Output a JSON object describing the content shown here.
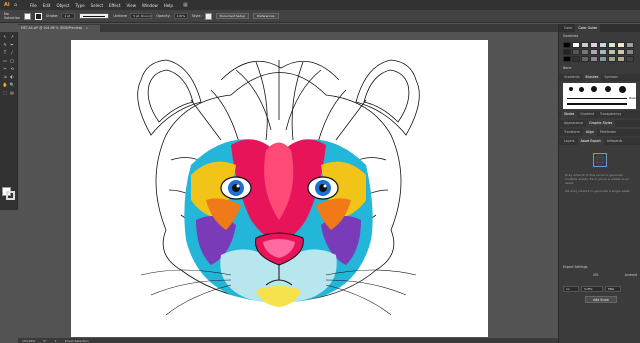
{
  "menubar": {
    "logo": "Ai",
    "home": "⌂",
    "items": [
      "File",
      "Edit",
      "Object",
      "Type",
      "Select",
      "Effect",
      "View",
      "Window",
      "Help"
    ],
    "grid": "▦"
  },
  "options": {
    "selection_label": "No Selection",
    "stroke_label": "Stroke:",
    "stroke_weight": "1 pt",
    "profile": "Uniform",
    "brush": "5 pt. Round",
    "opacity_label": "Opacity:",
    "opacity_value": "100%",
    "style_label": "Style:",
    "doc_setup": "Document Setup",
    "preferences": "Preferences"
  },
  "document_tab": {
    "title": "MET-A4.ai* @ 104.96 % (RGB/Preview)",
    "close": "×"
  },
  "tools": [
    "↖",
    "↗",
    "✎",
    "✒",
    "T",
    "/",
    "▭",
    "◯",
    "✂",
    "⟲",
    "⇲",
    "◐",
    "✋",
    "🔍",
    "⬚",
    "▤"
  ],
  "right_dock": {
    "top_tabs": [
      "Color",
      "Color Guide"
    ],
    "swatches_label": "Swatches",
    "swatch_colors": [
      "#000000",
      "#ffffff",
      "#cccccc",
      "#e0d0d8",
      "#c8d8e0",
      "#d8e8d0",
      "#f0e8d0",
      "#a0a0a0",
      "#222222",
      "#555555",
      "#777777",
      "#b0a8b0",
      "#a8b8c0",
      "#b8c8b0",
      "#d0c8b0",
      "#888888",
      "#000000",
      "#333333",
      "#666666",
      "#908890",
      "#8898a0",
      "#98a890",
      "#b0a890",
      "#444444"
    ],
    "none_label": "None",
    "panel_tabs_1": [
      "Gradients",
      "Brushes",
      "Symbols"
    ],
    "brush_name": "Basic",
    "panel_tabs_2": [
      "Stroke",
      "Gradient",
      "Transparency"
    ],
    "panel_tabs_3": [
      "Appearance",
      "Graphic Styles"
    ],
    "panel_tabs_4": [
      "Transform",
      "Align",
      "Pathfinder"
    ],
    "panel_tabs_5": [
      "Layers",
      "Asset Export",
      "Artboards"
    ],
    "asset_hint_1": "Drag artwork to this panel to generate multiple assets. Each group is added as an asset.",
    "asset_hint_2": "Alt-drag artwork to generate a single asset.",
    "export_settings": "Export Settings",
    "ios": "iOS",
    "android": "Android",
    "scale": "1x",
    "suffix": "Suffix",
    "format": "PNG",
    "add_scale": "Add Scale"
  },
  "status": {
    "zoom": "104.96%",
    "angle": "0°",
    "artboard": "1",
    "tool": "Direct Selection"
  }
}
